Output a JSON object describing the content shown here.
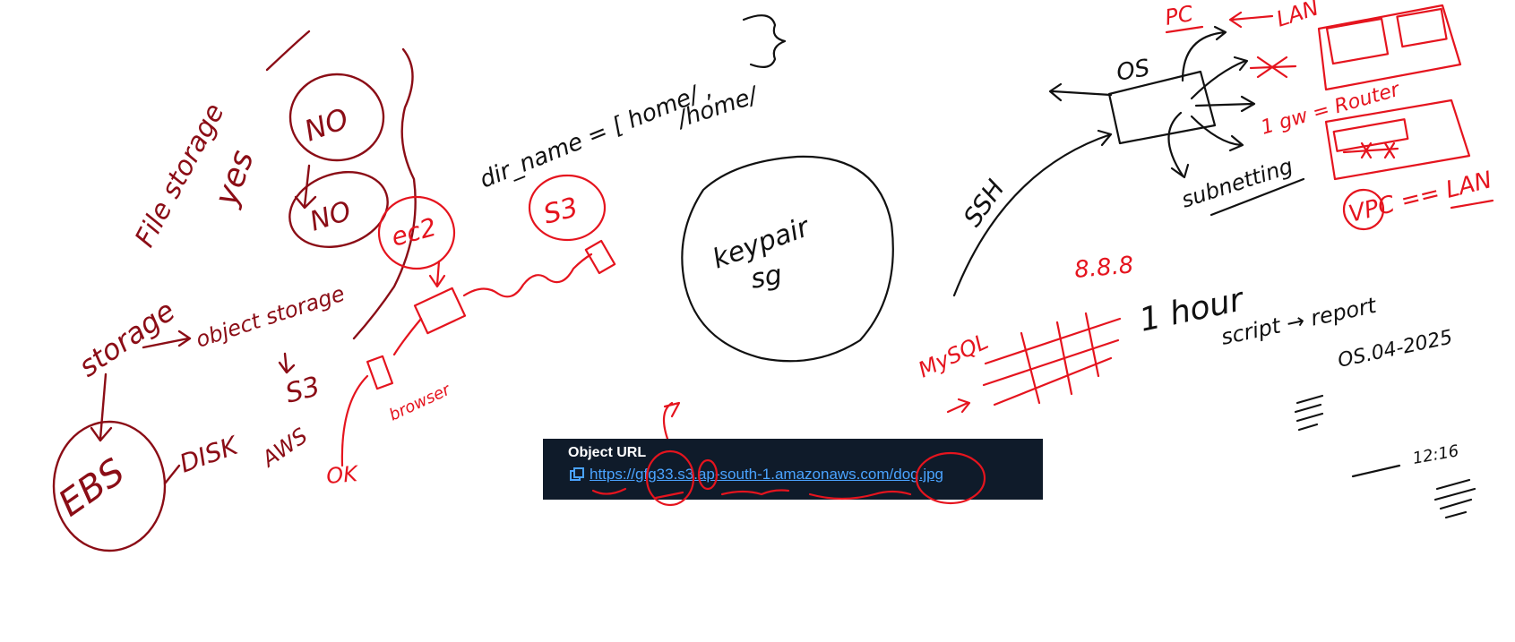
{
  "object_url": {
    "title": "Object URL",
    "link": "https://gfg33.s3.ap-south-1.amazonaws.com/dog.jpg",
    "copy_icon": "copy-icon"
  },
  "notes": {
    "file_storage": "File storage",
    "yes": "yes",
    "no_1": "NO",
    "no_2": "NO",
    "object_storage": "object storage",
    "storage": "storage",
    "ebs": "EBS",
    "disk": "DISK",
    "s3_left": "S3",
    "aws": "AWS",
    "ok": "OK",
    "ec2": "ec2",
    "s3_circle": "S3",
    "browser": "browser",
    "dir_name": "dir_name = [ home/ ,",
    "home2": "/home/",
    "keypair": "keypair",
    "sg": "sg",
    "ssh": "SSH",
    "os": "OS",
    "subnet": "subnetting",
    "pc": "PC",
    "lan_top": "LAN",
    "router": "1 gw = Router",
    "vpc_lan": "VPC == LAN",
    "ip": "8.8.8",
    "mysql": "MySQL",
    "one_hour": "1 hour",
    "script_report": "script → report",
    "os_date": "OS.04-2025",
    "time": "12:16"
  }
}
